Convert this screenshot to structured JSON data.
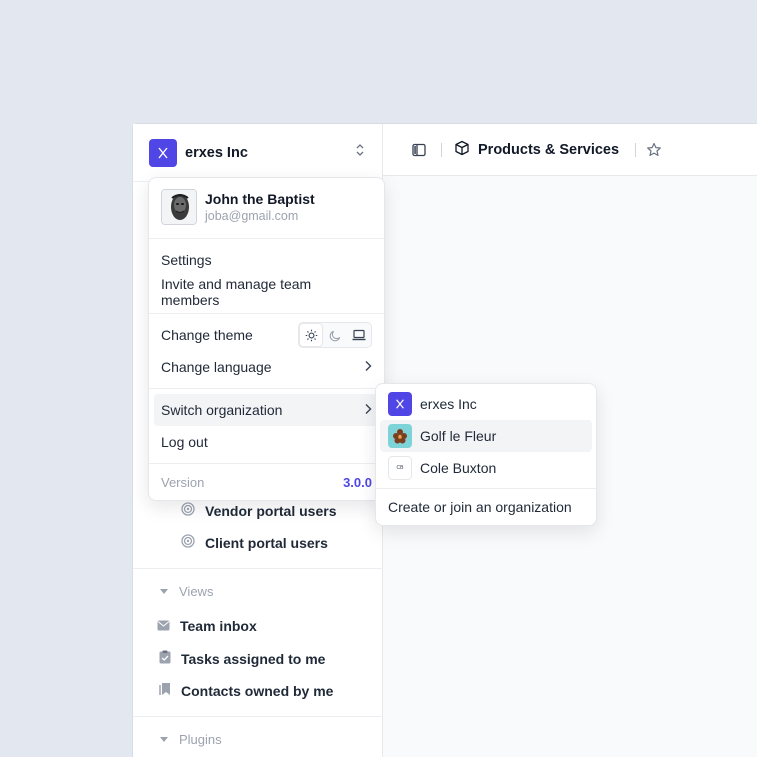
{
  "header": {
    "breadcrumb": "Products & Services"
  },
  "org": {
    "name": "erxes Inc"
  },
  "sidebar": {
    "items": [
      {
        "label": "Vendor portal users"
      },
      {
        "label": "Client portal users"
      }
    ],
    "views_title": "Views",
    "views": [
      {
        "label": "Team inbox"
      },
      {
        "label": "Tasks assigned to me"
      },
      {
        "label": "Contacts owned by me"
      }
    ],
    "plugins_title": "Plugins"
  },
  "user_menu": {
    "name": "John the Baptist",
    "email": "joba@gmail.com",
    "settings": "Settings",
    "invite": "Invite and manage team members",
    "change_theme": "Change theme",
    "change_language": "Change language",
    "switch_org": "Switch organization",
    "logout": "Log out",
    "version_label": "Version",
    "version": "3.0.0"
  },
  "org_menu": {
    "orgs": [
      {
        "name": "erxes Inc"
      },
      {
        "name": "Golf le Fleur"
      },
      {
        "name": "Cole Buxton",
        "logo_text": "CB"
      }
    ],
    "create": "Create or join an organization"
  },
  "colors": {
    "accent": "#4f46e5",
    "golf_logo_bg": "#7dd3d8"
  }
}
